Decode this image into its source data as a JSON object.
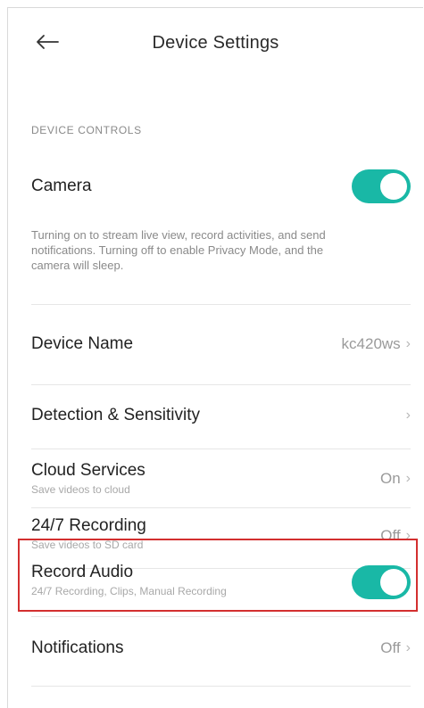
{
  "header": {
    "back_icon": "arrow-left-icon",
    "title": "Device Settings"
  },
  "section": {
    "label": "DEVICE CONTROLS"
  },
  "camera": {
    "title": "Camera",
    "toggle_on": true,
    "description": "Turning on to stream live view, record activities, and send notifications. Turning off to enable Privacy Mode, and the camera will sleep."
  },
  "rows": {
    "device_name": {
      "title": "Device Name",
      "value": "kc420ws"
    },
    "detection": {
      "title": "Detection & Sensitivity",
      "value": ""
    },
    "cloud": {
      "title": "Cloud Services",
      "subtitle": "Save videos to cloud",
      "value": "On"
    },
    "recording": {
      "title": "24/7 Recording",
      "subtitle": "Save videos to SD card",
      "value": "Off"
    },
    "record_audio": {
      "title": "Record Audio",
      "subtitle": "24/7 Recording, Clips, Manual Recording",
      "toggle_on": true
    },
    "notifications": {
      "title": "Notifications",
      "value": "Off"
    }
  },
  "chevron_icon": "chevron-right-icon",
  "colors": {
    "toggle_on": "#19b8a6",
    "highlight": "#d32f2f"
  }
}
